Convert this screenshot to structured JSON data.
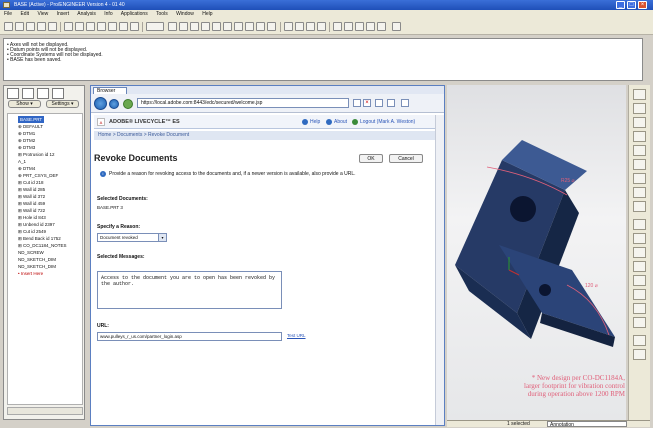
{
  "window": {
    "title": "BASE (Active) - Pro/ENGINEER Version 4 - 01 40"
  },
  "menu": [
    "File",
    "Edit",
    "View",
    "Insert",
    "Analysis",
    "Info",
    "Applications",
    "Tools",
    "Window",
    "Help"
  ],
  "messages": [
    "• Axes will not be displayed.",
    "• Datum points will not be displayed.",
    "• Coordinate Systems will not be displayed.",
    "• BASE has been saved."
  ],
  "left": {
    "show_btn": "Show ▾",
    "settings_btn": "Settings ▾",
    "tree": [
      "BASE.PRT",
      "⊕ DEFAULT",
      "⊕ DTM1",
      "⊕ DTM2",
      "⊕ DTM3",
      "⊞ Protrusion id 12",
      "A_1",
      "⊕ DTM4",
      "⊕ PRT_CSYS_DEF",
      "⊞ Cut id 218",
      "⊞ Wall id 285",
      "⊞ Wall id 372",
      "⊞ Wall id 459",
      "⊞ Wall id 722",
      "⊞ Hole id 843",
      "⊞ Unbend id 2397",
      "⊞ Cut id 2549",
      "⊞ Bend Back id 1752",
      "⊞ CO_DC1184_NOTES",
      "   ND_SCREW",
      "   ND_SKETCH_DIM",
      "   ND_SKETCH_DIM",
      "• Insert Here"
    ]
  },
  "browser": {
    "tab": "Browser",
    "url": "https://local.adobe.com:8443/edc/secured/welcome.jsp",
    "brand": "ADOBE® LIVECYCLE™ ES",
    "help": "Help",
    "about": "About",
    "logout": "Logout (Mark A. Weston)",
    "breadcrumb": "Home > Documents > Revoke Document",
    "title": "Revoke Documents",
    "ok": "OK",
    "cancel": "Cancel",
    "instructions": "Provide a reason for revoking access to the documents and, if a newer version is available, also provide a URL.",
    "selected_docs_label": "Selected Documents:",
    "selected_doc": "BASE.PRT 3",
    "reason_label": "Specify a Reason:",
    "reason_value": "Document revoked",
    "msg_label": "Selected Messages:",
    "msg_text": "Access to the document you are to open has been revoked by the author.",
    "url_label": "URL:",
    "url_value": "www.pulleys_r_us.com/partner_login.asp",
    "test_url": "Test URL"
  },
  "viewport": {
    "dim1": "R25 ⌀",
    "dim2": "120 ⌀",
    "annotation": "* New design per CO-DC1184A, larger footprint for vibration control during operation above 1200 RPM"
  },
  "status": {
    "selected": "1 selected",
    "filter": "Annotation"
  }
}
